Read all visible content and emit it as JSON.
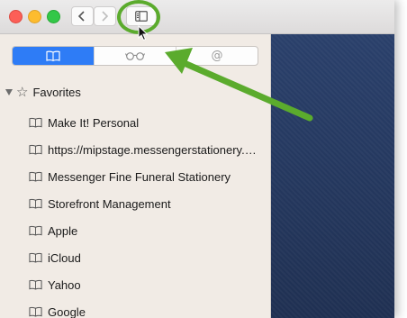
{
  "colors": {
    "accent_green": "#5bab2d",
    "segment_active": "#2e7cf6",
    "content_bg": "#23365c"
  },
  "toolbar": {
    "back_icon": "chevron-left-icon",
    "forward_icon": "chevron-right-icon",
    "sidebar_toggle_icon": "sidebar-icon"
  },
  "sidebar": {
    "segments": [
      {
        "icon": "book-icon",
        "active": true
      },
      {
        "icon": "glasses-icon",
        "active": false
      },
      {
        "icon": "at-icon",
        "glyph": "@",
        "active": false
      }
    ],
    "section_title": "Favorites",
    "items": [
      {
        "label": "Make It! Personal"
      },
      {
        "label": "https://mipstage.messengerstationery.com/"
      },
      {
        "label": "Messenger Fine Funeral Stationery"
      },
      {
        "label": "Storefront Management"
      },
      {
        "label": "Apple"
      },
      {
        "label": "iCloud"
      },
      {
        "label": "Yahoo"
      },
      {
        "label": "Google"
      }
    ]
  }
}
